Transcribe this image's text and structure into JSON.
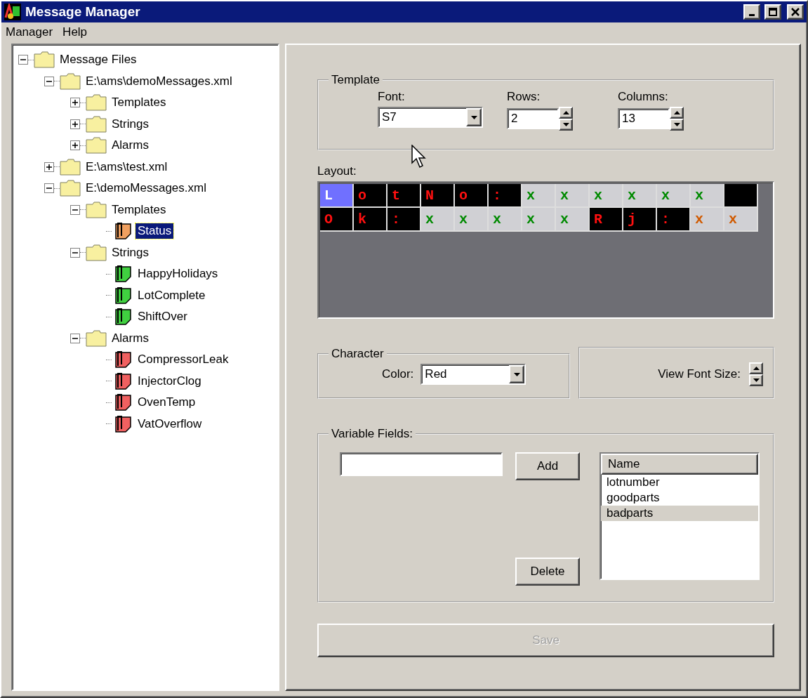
{
  "window": {
    "title": "Message Manager"
  },
  "menu": [
    {
      "label": "Manager"
    },
    {
      "label": "Help"
    }
  ],
  "tree": [
    {
      "label": "Message Files",
      "kind": "folder",
      "expanded": true,
      "selected": false,
      "children": [
        {
          "label": "E:\\ams\\demoMessages.xml",
          "kind": "folder",
          "expanded": true,
          "selected": false,
          "children": [
            {
              "label": "Templates",
              "kind": "folder",
              "expanded": false,
              "selected": false
            },
            {
              "label": "Strings",
              "kind": "folder",
              "expanded": false,
              "selected": false
            },
            {
              "label": "Alarms",
              "kind": "folder",
              "expanded": false,
              "selected": false
            }
          ]
        },
        {
          "label": "E:\\ams\\test.xml",
          "kind": "folder",
          "expanded": false,
          "selected": false
        },
        {
          "label": "E:\\demoMessages.xml",
          "kind": "folder",
          "expanded": true,
          "selected": false,
          "children": [
            {
              "label": "Templates",
              "kind": "folder",
              "expanded": true,
              "selected": false,
              "children": [
                {
                  "label": "Status",
                  "kind": "template",
                  "selected": true
                }
              ]
            },
            {
              "label": "Strings",
              "kind": "folder",
              "expanded": true,
              "selected": false,
              "children": [
                {
                  "label": "HappyHolidays",
                  "kind": "string",
                  "selected": false
                },
                {
                  "label": "LotComplete",
                  "kind": "string",
                  "selected": false
                },
                {
                  "label": "ShiftOver",
                  "kind": "string",
                  "selected": false
                }
              ]
            },
            {
              "label": "Alarms",
              "kind": "folder",
              "expanded": true,
              "selected": false,
              "children": [
                {
                  "label": "CompressorLeak",
                  "kind": "alarm",
                  "selected": false
                },
                {
                  "label": "InjectorClog",
                  "kind": "alarm",
                  "selected": false
                },
                {
                  "label": "OvenTemp",
                  "kind": "alarm",
                  "selected": false
                },
                {
                  "label": "VatOverflow",
                  "kind": "alarm",
                  "selected": false
                }
              ]
            }
          ]
        }
      ]
    }
  ],
  "template": {
    "title": "Template",
    "font": {
      "label": "Font:",
      "value": "S7"
    },
    "rows": {
      "label": "Rows:",
      "value": "2"
    },
    "columns": {
      "label": "Columns:",
      "value": "13"
    }
  },
  "layout": {
    "label": "Layout:",
    "rows": [
      [
        {
          "char": "L",
          "kind": "cursor",
          "color": "#ffffff"
        },
        {
          "char": "o",
          "kind": "text",
          "color": "#ff1010"
        },
        {
          "char": "t",
          "kind": "text",
          "color": "#ff1010"
        },
        {
          "char": "N",
          "kind": "text",
          "color": "#ff1010"
        },
        {
          "char": "o",
          "kind": "text",
          "color": "#ff1010"
        },
        {
          "char": ":",
          "kind": "text",
          "color": "#ff1010"
        },
        {
          "char": "x",
          "kind": "field",
          "color": "#008a00"
        },
        {
          "char": "x",
          "kind": "field",
          "color": "#008a00"
        },
        {
          "char": "x",
          "kind": "field",
          "color": "#008a00"
        },
        {
          "char": "x",
          "kind": "field",
          "color": "#008a00"
        },
        {
          "char": "x",
          "kind": "field",
          "color": "#008a00"
        },
        {
          "char": "x",
          "kind": "field",
          "color": "#008a00"
        },
        {
          "kind": "blank"
        }
      ],
      [
        {
          "char": "O",
          "kind": "text",
          "color": "#ff1010"
        },
        {
          "char": "k",
          "kind": "text",
          "color": "#ff1010"
        },
        {
          "char": ":",
          "kind": "text",
          "color": "#ff1010"
        },
        {
          "char": "x",
          "kind": "field",
          "color": "#008a00"
        },
        {
          "char": "x",
          "kind": "field",
          "color": "#008a00"
        },
        {
          "char": "x",
          "kind": "field",
          "color": "#008a00"
        },
        {
          "char": "x",
          "kind": "field",
          "color": "#008a00"
        },
        {
          "char": "x",
          "kind": "field",
          "color": "#008a00"
        },
        {
          "char": "R",
          "kind": "text",
          "color": "#ff1010"
        },
        {
          "char": "j",
          "kind": "text",
          "color": "#ff1010"
        },
        {
          "char": ":",
          "kind": "text",
          "color": "#ff1010"
        },
        {
          "char": "x",
          "kind": "field",
          "color": "#d05a00"
        },
        {
          "char": "x",
          "kind": "field",
          "color": "#d05a00"
        }
      ]
    ]
  },
  "character": {
    "title": "Character",
    "color_label": "Color:",
    "color_value": "Red"
  },
  "view_font_size": {
    "label": "View Font Size:"
  },
  "variable_fields": {
    "title": "Variable Fields:",
    "add": "Add",
    "delete": "Delete",
    "column": "Name",
    "items": [
      {
        "name": "lotnumber",
        "selected": false
      },
      {
        "name": "goodparts",
        "selected": false
      },
      {
        "name": "badparts",
        "selected": true
      }
    ]
  },
  "save": {
    "label": "Save",
    "disabled": true
  }
}
